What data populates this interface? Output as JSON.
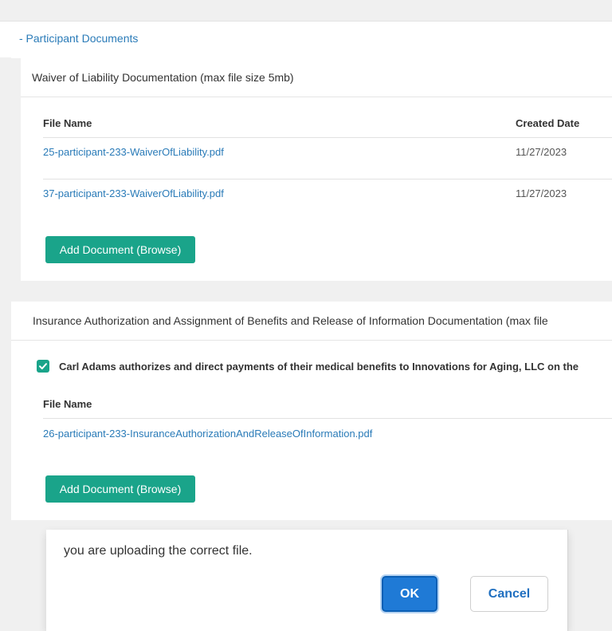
{
  "section": {
    "title": "- Participant Documents"
  },
  "waiver": {
    "heading": "Waiver of Liability Documentation (max file size 5mb)",
    "columns": {
      "file_name": "File Name",
      "created_date": "Created Date"
    },
    "rows": [
      {
        "file": "25-participant-233-WaiverOfLiability.pdf",
        "date": "11/27/2023"
      },
      {
        "file": "37-participant-233-WaiverOfLiability.pdf",
        "date": "11/27/2023"
      }
    ],
    "add_button": "Add Document (Browse)"
  },
  "insurance": {
    "heading": "Insurance Authorization and Assignment of Benefits and Release of Information Documentation (max file",
    "consent_checked": true,
    "consent_text": "Carl Adams authorizes and direct payments of their medical benefits to Innovations for Aging, LLC on the",
    "columns": {
      "file_name": "File Name"
    },
    "rows": [
      {
        "file": "26-participant-233-InsuranceAuthorizationAndReleaseOfInformation.pdf"
      }
    ],
    "add_button": "Add Document (Browse)"
  },
  "dialog": {
    "message": "you are uploading the correct file.",
    "ok_label": "OK",
    "cancel_label": "Cancel"
  },
  "colors": {
    "link": "#2a7bb8",
    "primary": "#1aa48a",
    "ok": "#1f7ad6"
  }
}
